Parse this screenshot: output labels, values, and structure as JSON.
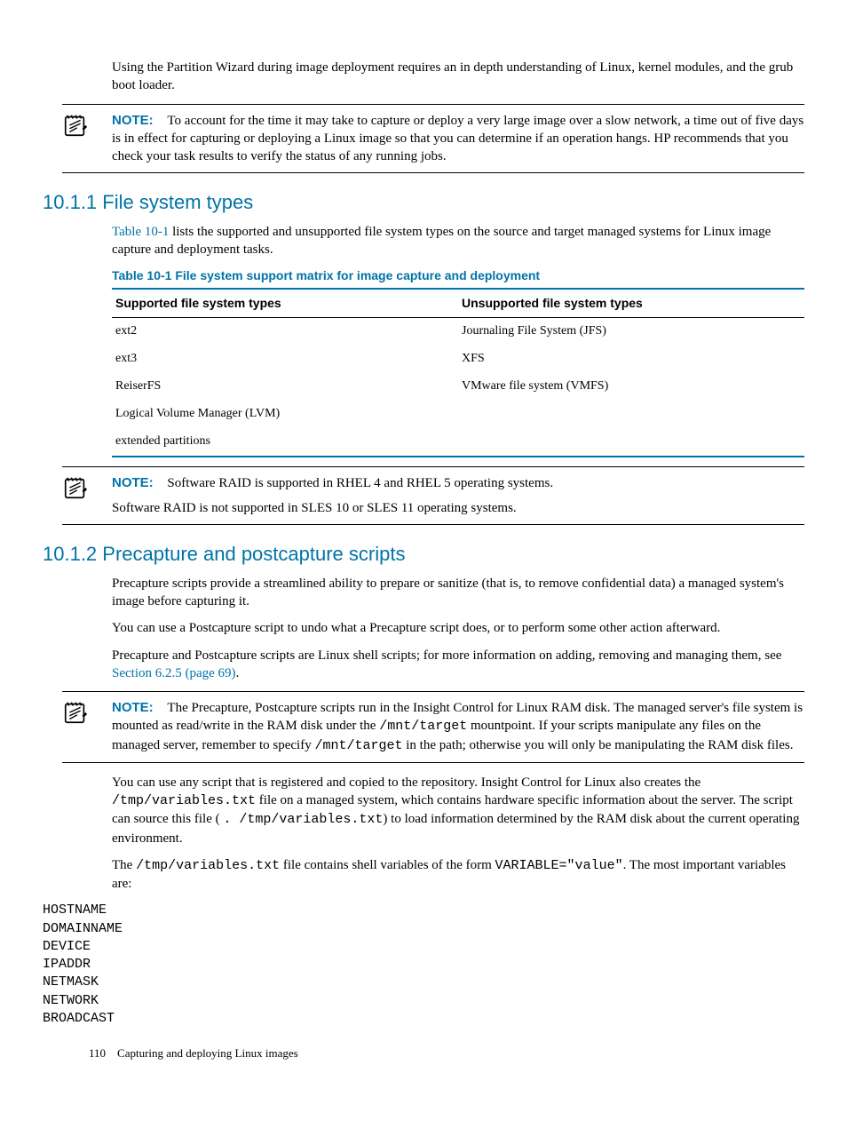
{
  "intro_paragraph": "Using the Partition Wizard during image deployment requires an in depth understanding of Linux, kernel modules, and the grub boot loader.",
  "note1": {
    "label": "NOTE:",
    "text": "To account for the time it may take to capture or deploy a very large image over a slow network, a time out of five days is in effect for capturing or deploying a Linux image so that you can determine if an operation hangs. HP recommends that you check your task results to verify the status of any running jobs."
  },
  "section_10_1_1": {
    "heading": "10.1.1 File system types",
    "intro_prefix": "",
    "link": "Table 10-1",
    "intro_suffix": " lists the supported and unsupported file system types on the source and target managed systems for Linux image capture and deployment tasks.",
    "table_caption": "Table 10-1 File system support matrix for image capture and deployment",
    "table": {
      "header_supported": "Supported file system types",
      "header_unsupported": "Unsupported file system types",
      "rows": [
        {
          "supported": "ext2",
          "unsupported": "Journaling File System (JFS)"
        },
        {
          "supported": "ext3",
          "unsupported": "XFS"
        },
        {
          "supported": "ReiserFS",
          "unsupported": "VMware file system (VMFS)"
        },
        {
          "supported": "Logical Volume Manager (LVM)",
          "unsupported": ""
        },
        {
          "supported": "extended partitions",
          "unsupported": ""
        }
      ]
    }
  },
  "note2": {
    "label": "NOTE:",
    "line1": "Software RAID is supported in RHEL 4 and RHEL 5 operating systems.",
    "line2": "Software RAID is not supported in SLES 10 or SLES 11 operating systems."
  },
  "section_10_1_2": {
    "heading": "10.1.2 Precapture and postcapture scripts",
    "p1": "Precapture scripts provide a streamlined ability to prepare or sanitize (that is, to remove confidential data) a managed system's image before capturing it.",
    "p2": "You can use a Postcapture script to undo what a Precapture script does, or to perform some other action afterward.",
    "p3_prefix": "Precapture and Postcapture scripts are Linux shell scripts; for more information on adding, removing and managing them, see ",
    "p3_link": "Section 6.2.5 (page 69)",
    "p3_suffix": "."
  },
  "note3": {
    "label": "NOTE:",
    "text_before_mono1": "The Precapture, Postcapture scripts run in the Insight Control for Linux RAM disk. The managed server's file system is mounted as read/write in the RAM disk under the ",
    "mono1": "/mnt/target",
    "text_mid": " mountpoint. If your scripts manipulate any files on the managed server, remember to specify ",
    "mono2": "/mnt/target",
    "text_after": " in the path; otherwise you will only be manipulating the RAM disk files."
  },
  "p_after_note3_a": {
    "t1": "You can use any script that is registered and copied to the repository. Insight Control for Linux also creates the ",
    "m1": "/tmp/variables.txt",
    "t2": " file on a managed system, which contains hardware specific information about the server. The script can source this file ( ",
    "m2": ". /tmp/variables.txt",
    "t3": ") to load information determined by the RAM disk about the current operating environment."
  },
  "p_after_note3_b": {
    "t1": "The ",
    "m1": "/tmp/variables.txt",
    "t2": " file contains shell variables of the form ",
    "m2": "VARIABLE=\"value\"",
    "t3": ". The most important variables are:"
  },
  "variables": [
    "HOSTNAME",
    "DOMAINNAME",
    "DEVICE",
    "IPADDR",
    "NETMASK",
    "NETWORK",
    "BROADCAST"
  ],
  "footer": {
    "page_number": "110",
    "chapter": "Capturing and deploying Linux images"
  }
}
